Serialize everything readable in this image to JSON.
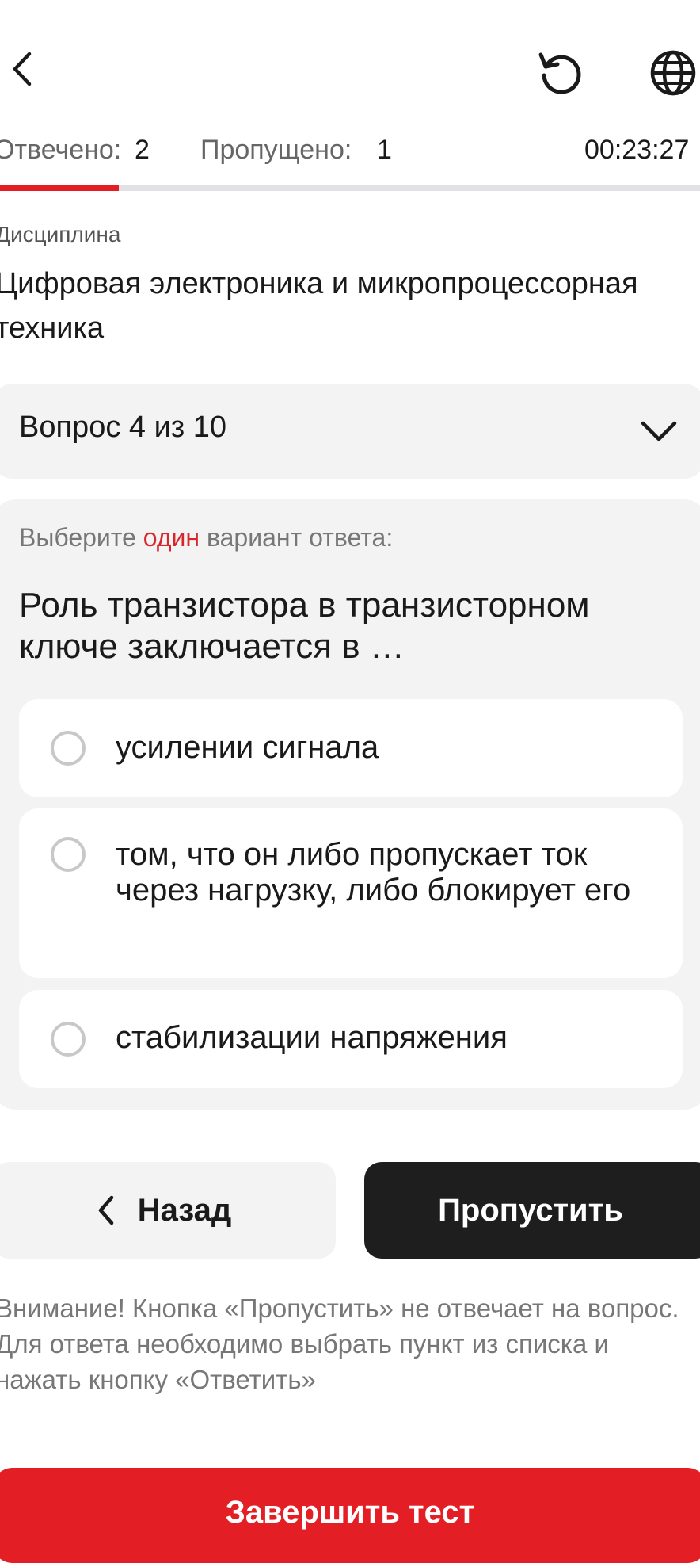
{
  "header": {
    "back_icon": "chevron-left-icon",
    "restart_icon": "restart-icon",
    "language_icon": "globe-icon"
  },
  "stats": {
    "answered_label": "Отвечено:",
    "answered_value": "2",
    "skipped_label": "Пропущено:",
    "skipped_value": "1",
    "timer": "00:23:27"
  },
  "progress": {
    "fraction": 0.17,
    "fill_color": "#e31e24",
    "track_color": "#e2e2e6"
  },
  "discipline": {
    "label": "Дисциплина",
    "title": "Цифровая электроника и микропроцессорная техника"
  },
  "question_selector": {
    "label": "Вопрос 4 из 10",
    "icon": "chevron-down-icon"
  },
  "question": {
    "instruction_prefix": "Выберите ",
    "instruction_highlight": "один",
    "instruction_suffix": " вариант ответа:",
    "highlight_color": "#d8262d",
    "text": "Роль транзистора в транзисторном ключе заключается в …",
    "options": [
      {
        "label": "усилении сигнала",
        "selected": false
      },
      {
        "label": "том, что он либо пропускает ток через нагрузку, либо блокирует его",
        "selected": false
      },
      {
        "label": "стабилизации напряжения",
        "selected": false
      }
    ]
  },
  "actions": {
    "back_label": "Назад",
    "skip_label": "Пропустить",
    "finish_label": "Завершить тест",
    "finish_color": "#e31e24"
  },
  "warning": "Внимание! Кнопка «Пропустить» не отвечает на вопрос. Для ответа необходимо выбрать пункт из списка и нажать кнопку «Ответить»"
}
